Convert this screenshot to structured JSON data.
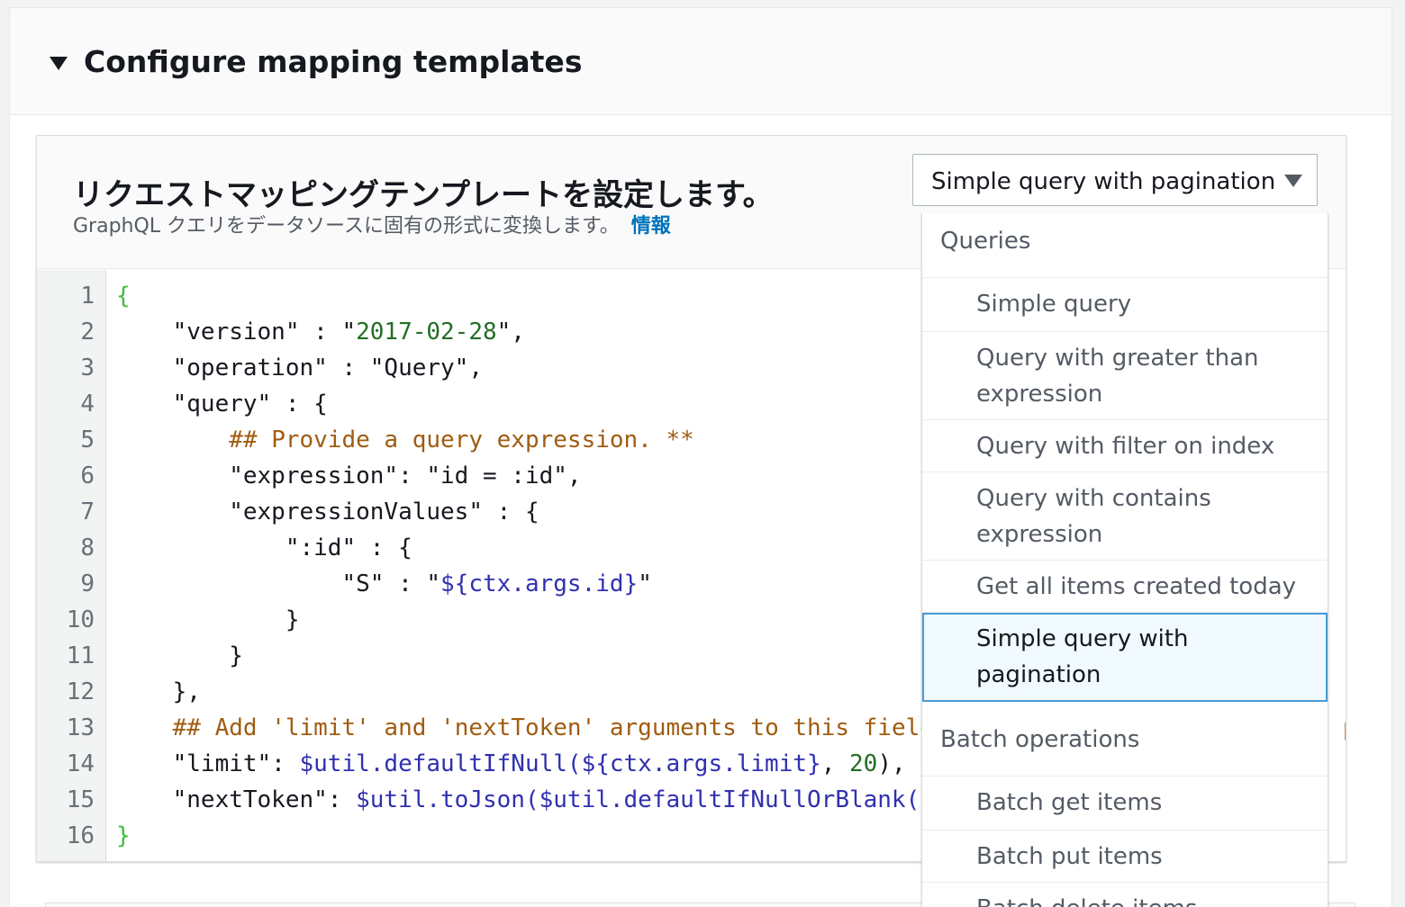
{
  "section": {
    "title": "Configure mapping templates"
  },
  "panel": {
    "title": "リクエストマッピングテンプレートを設定します。",
    "description": "GraphQL クエリをデータソースに固有の形式に変換します。",
    "info_link": "情報"
  },
  "select": {
    "value": "Simple query with pagination"
  },
  "editor": {
    "line_numbers": [
      "1",
      "2",
      "3",
      "4",
      "5",
      "6",
      "7",
      "8",
      "9",
      "10",
      "11",
      "12",
      "13",
      "14",
      "15",
      "16"
    ]
  },
  "dropdown": {
    "groups": [
      {
        "label": "Queries",
        "options": [
          "Simple query",
          "Query with greater than expression",
          "Query with filter on index",
          "Query with contains expression",
          "Get all items created today",
          "Simple query with pagination"
        ]
      },
      {
        "label": "Batch operations",
        "options": [
          "Batch get items",
          "Batch put items",
          "Batch delete items"
        ]
      }
    ],
    "selected": "Simple query with pagination"
  },
  "colors": {
    "link": "#0073bb",
    "selected_border": "#4a9bd4",
    "selected_bg": "#f1faff",
    "comment": "#a05c11",
    "string": "#236e25",
    "variable": "#3030b0",
    "brace": "#3dbd3d"
  }
}
